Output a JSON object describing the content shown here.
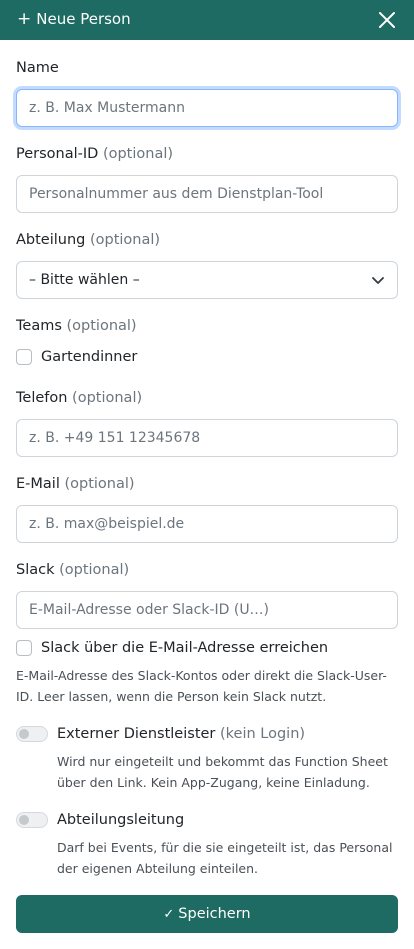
{
  "header": {
    "plus": "+",
    "title": "Neue Person"
  },
  "name": {
    "label": "Name",
    "placeholder": "z. B. Max Mustermann"
  },
  "personal_id": {
    "label": "Personal-ID",
    "optional": "(optional)",
    "placeholder": "Personalnummer aus dem Dienstplan-Tool"
  },
  "department": {
    "label": "Abteilung",
    "optional": "(optional)",
    "selected": "– Bitte wählen –"
  },
  "teams": {
    "label": "Teams",
    "optional": "(optional)",
    "items": [
      {
        "label": "Gartendinner",
        "checked": false
      }
    ]
  },
  "phone": {
    "label": "Telefon",
    "optional": "(optional)",
    "placeholder": "z. B. +49 151 12345678"
  },
  "email": {
    "label": "E-Mail",
    "optional": "(optional)",
    "placeholder": "z. B. max@beispiel.de"
  },
  "slack": {
    "label": "Slack",
    "optional": "(optional)",
    "placeholder": "E-Mail-Adresse oder Slack-ID (U…)",
    "checkbox_label": "Slack über die E-Mail-Adresse erreichen",
    "help": "E-Mail-Adresse des Slack-Kontos oder direkt die Slack-User-ID. Leer lassen, wenn die Person kein Slack nutzt."
  },
  "external": {
    "label": "Externer Dienstleister",
    "suffix": "(kein Login)",
    "help": "Wird nur eingeteilt und bekommt das Function Sheet über den Link. Kein App-Zugang, keine Einladung.",
    "on": false
  },
  "head": {
    "label": "Abteilungsleitung",
    "help": "Darf bei Events, für die sie eingeteilt ist, das Personal der eigenen Abteilung einteilen.",
    "on": false
  },
  "save": {
    "check": "✓",
    "label": "Speichern"
  },
  "colors": {
    "primary": "#1d6b62",
    "focus": "#86b7fe"
  }
}
